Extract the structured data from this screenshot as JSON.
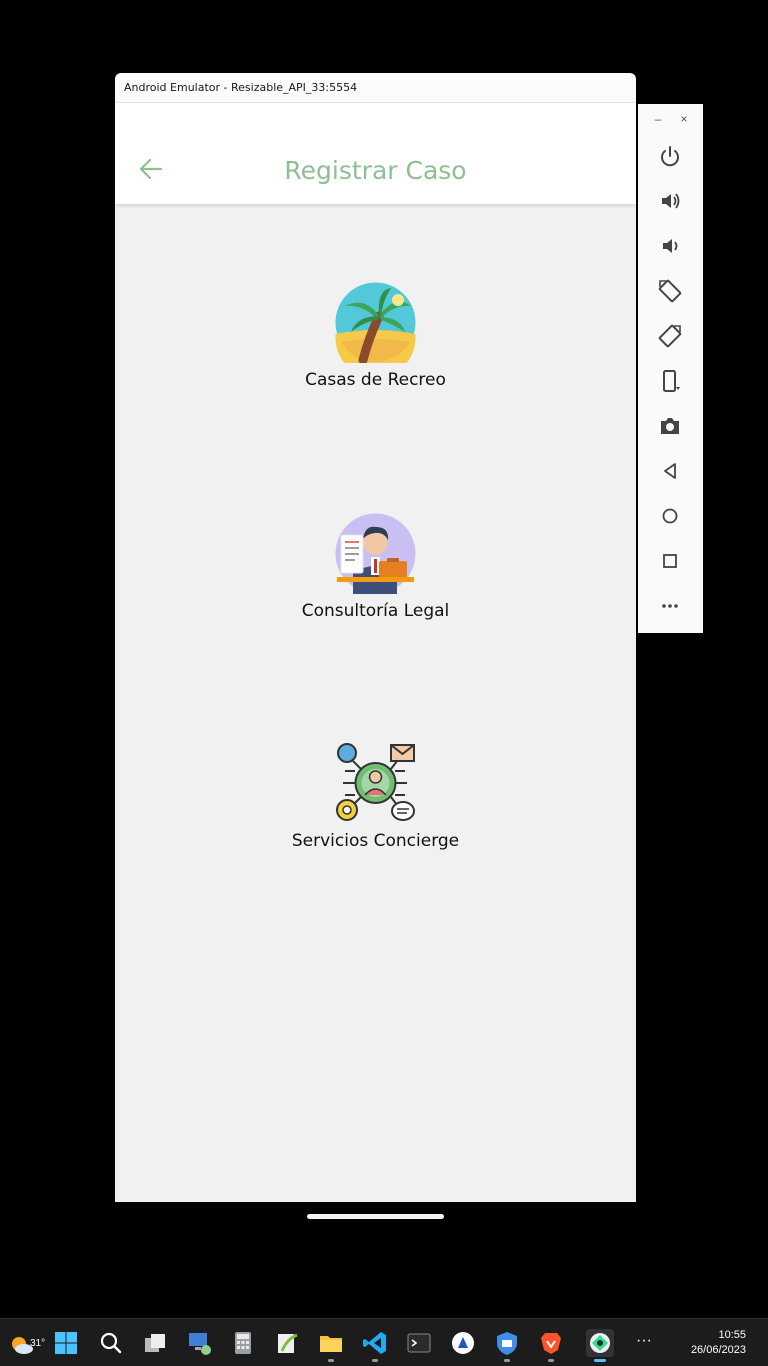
{
  "window": {
    "title": "Android Emulator - Resizable_API_33:5554"
  },
  "appbar": {
    "title": "Registrar Caso",
    "back_icon": "arrow-back-icon"
  },
  "menu": [
    {
      "label": "Casas de Recreo",
      "icon": "palm-beach-icon"
    },
    {
      "label": "Consultoría Legal",
      "icon": "lawyer-icon"
    },
    {
      "label": "Servicios Concierge",
      "icon": "concierge-network-icon"
    }
  ],
  "colors": {
    "accent": "#8fbf91",
    "background": "#f1f1f1",
    "appbar": "#ffffff"
  },
  "emulator_toolbar": {
    "buttons": [
      "power-icon",
      "volume-up-icon",
      "volume-down-icon",
      "rotate-left-icon",
      "rotate-right-icon",
      "fold-icon",
      "camera-icon",
      "back-icon",
      "home-icon",
      "overview-icon",
      "more-icon"
    ],
    "minimize": "–",
    "close": "×"
  },
  "taskbar": {
    "weather": {
      "temp": "31°"
    },
    "clock": {
      "time": "10:55",
      "date": "26/06/2023"
    },
    "more_label": "···"
  }
}
